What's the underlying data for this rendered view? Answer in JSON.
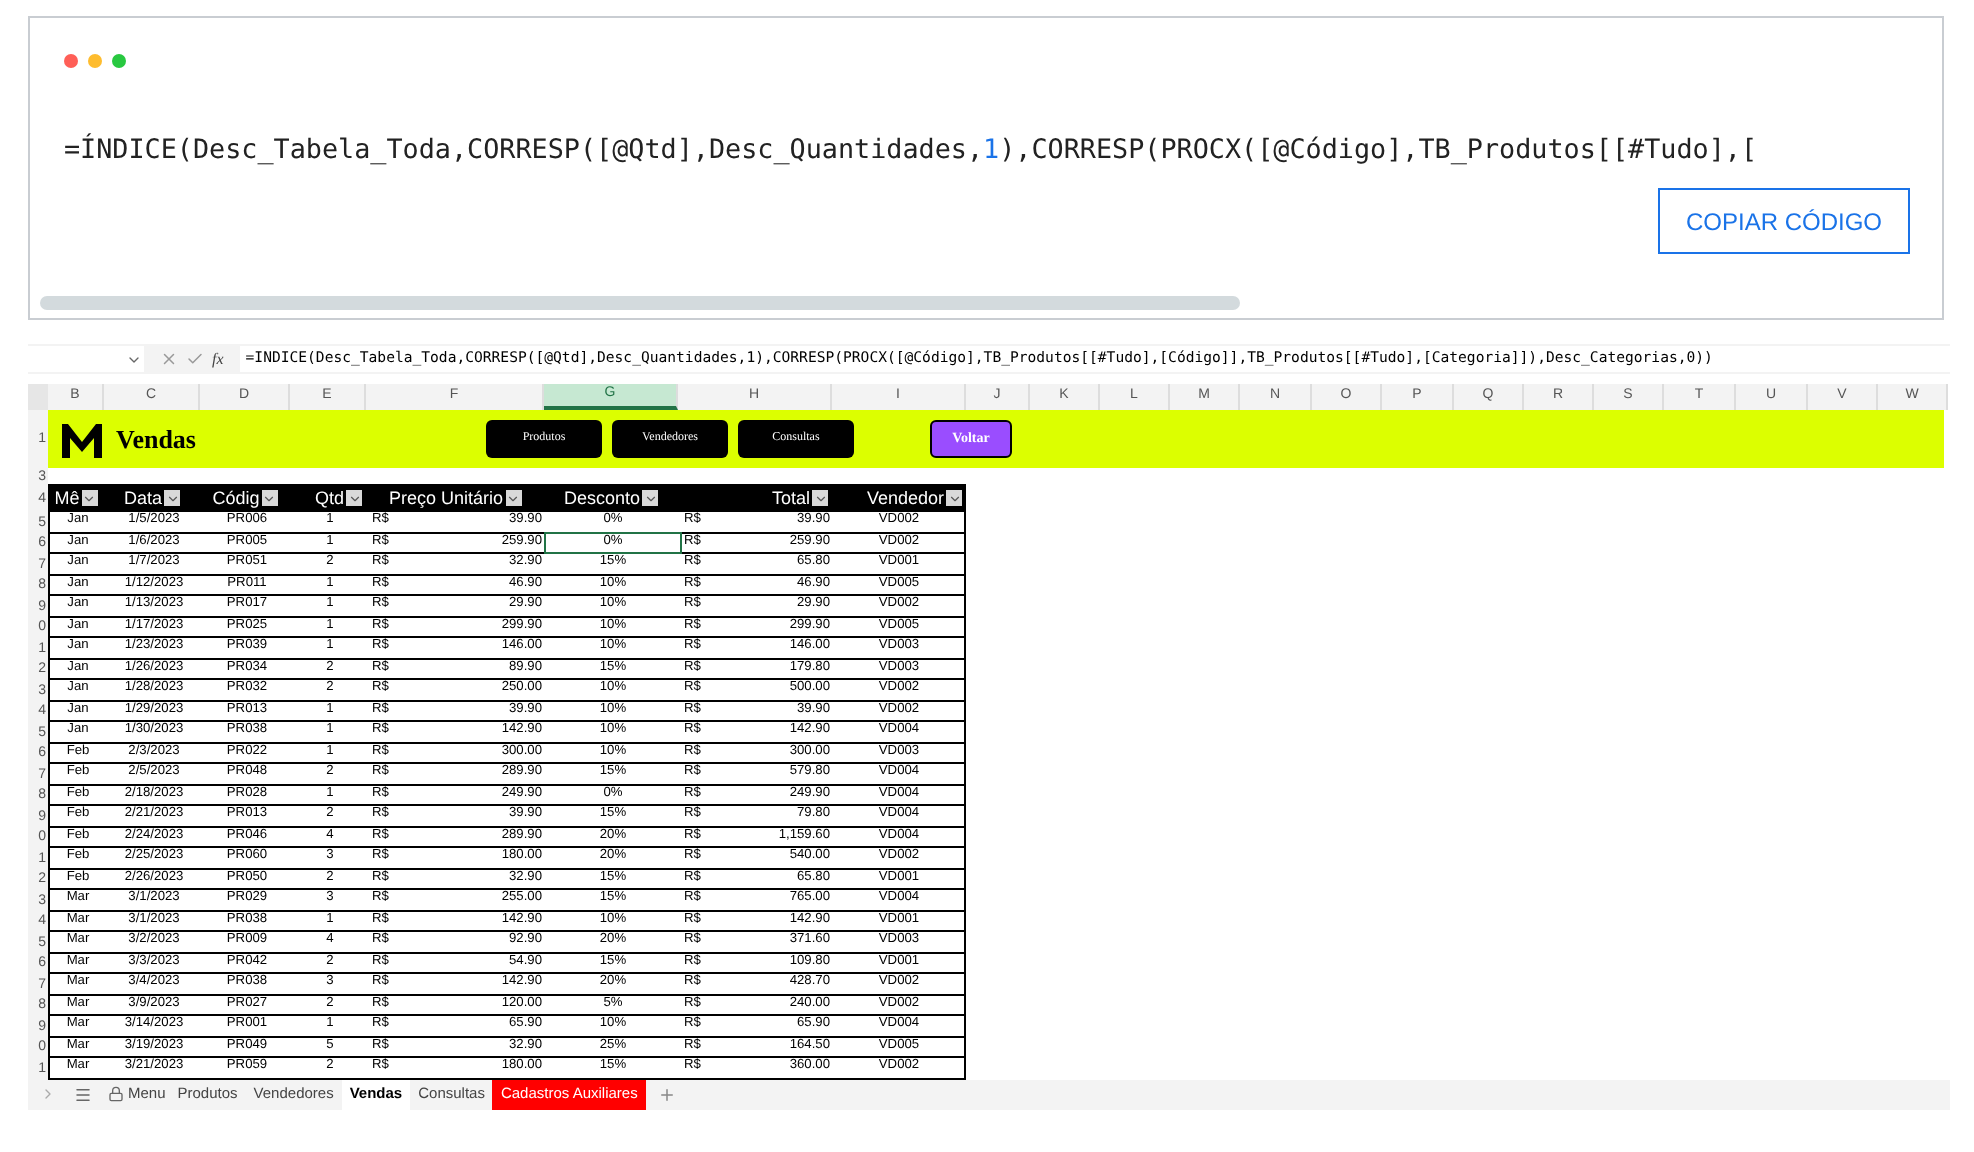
{
  "code_block": {
    "code_parts": [
      {
        "kind": "plain",
        "text": "=ÍNDICE(Desc_Tabela_Toda,CORRESP([@Qtd],Desc_Quantidades,"
      },
      {
        "kind": "number",
        "text": "1"
      },
      {
        "kind": "plain",
        "text": "),CORRESP(PROCX([@Código],TB_Produtos[[#Tudo],["
      }
    ],
    "copy_button": "COPIAR CÓDIGO"
  },
  "formula_bar": {
    "formula": "=INDICE(Desc_Tabela_Toda,CORRESP([@Qtd],Desc_Quantidades,1),CORRESP(PROCX([@Código],TB_Produtos[[#Tudo],[Código]],TB_Produtos[[#Tudo],[Categoria]]),Desc_Categorias,0))",
    "fx": "fx"
  },
  "column_headers": [
    {
      "label": "B",
      "selected": false
    },
    {
      "label": "C",
      "selected": false
    },
    {
      "label": "D",
      "selected": false
    },
    {
      "label": "E",
      "selected": false
    },
    {
      "label": "F",
      "selected": false
    },
    {
      "label": "G",
      "selected": true
    },
    {
      "label": "H",
      "selected": false
    },
    {
      "label": "I",
      "selected": false
    },
    {
      "label": "J",
      "selected": false
    },
    {
      "label": "K",
      "selected": false
    },
    {
      "label": "L",
      "selected": false
    },
    {
      "label": "M",
      "selected": false
    },
    {
      "label": "N",
      "selected": false
    },
    {
      "label": "O",
      "selected": false
    },
    {
      "label": "P",
      "selected": false
    },
    {
      "label": "Q",
      "selected": false
    },
    {
      "label": "R",
      "selected": false
    },
    {
      "label": "S",
      "selected": false
    },
    {
      "label": "T",
      "selected": false
    },
    {
      "label": "U",
      "selected": false
    },
    {
      "label": "V",
      "selected": false
    },
    {
      "label": "W",
      "selected": false
    }
  ],
  "banner": {
    "row_label": "1",
    "title": "Vendas",
    "nav_buttons": [
      "Produtos",
      "Vendedores",
      "Consultas"
    ],
    "back_button": "Voltar"
  },
  "spacer_row_label": "3",
  "table": {
    "row_label": "4",
    "columns": [
      "Mê",
      "Data",
      "Códig",
      "Qtd",
      "Preço Unitário",
      "Desconto",
      "Total",
      "Vendedor"
    ],
    "rows": [
      {
        "row_label": "5",
        "selected": false,
        "cells": [
          "Jan",
          "1/5/2023",
          "PR006",
          "1",
          {
            "currency": "R$",
            "amount": "39.90"
          },
          "0%",
          {
            "currency": "R$",
            "amount": "39.90"
          },
          "VD002"
        ]
      },
      {
        "row_label": "6",
        "selected": true,
        "cells": [
          "Jan",
          "1/6/2023",
          "PR005",
          "1",
          {
            "currency": "R$",
            "amount": "259.90"
          },
          "0%",
          {
            "currency": "R$",
            "amount": "259.90"
          },
          "VD002"
        ]
      },
      {
        "row_label": "7",
        "selected": false,
        "cells": [
          "Jan",
          "1/7/2023",
          "PR051",
          "2",
          {
            "currency": "R$",
            "amount": "32.90"
          },
          "15%",
          {
            "currency": "R$",
            "amount": "65.80"
          },
          "VD001"
        ]
      },
      {
        "row_label": "8",
        "selected": false,
        "cells": [
          "Jan",
          "1/12/2023",
          "PR011",
          "1",
          {
            "currency": "R$",
            "amount": "46.90"
          },
          "10%",
          {
            "currency": "R$",
            "amount": "46.90"
          },
          "VD005"
        ]
      },
      {
        "row_label": "9",
        "selected": false,
        "cells": [
          "Jan",
          "1/13/2023",
          "PR017",
          "1",
          {
            "currency": "R$",
            "amount": "29.90"
          },
          "10%",
          {
            "currency": "R$",
            "amount": "29.90"
          },
          "VD002"
        ]
      },
      {
        "row_label": "0",
        "selected": false,
        "cells": [
          "Jan",
          "1/17/2023",
          "PR025",
          "1",
          {
            "currency": "R$",
            "amount": "299.90"
          },
          "10%",
          {
            "currency": "R$",
            "amount": "299.90"
          },
          "VD005"
        ]
      },
      {
        "row_label": "1",
        "selected": false,
        "cells": [
          "Jan",
          "1/23/2023",
          "PR039",
          "1",
          {
            "currency": "R$",
            "amount": "146.00"
          },
          "10%",
          {
            "currency": "R$",
            "amount": "146.00"
          },
          "VD003"
        ]
      },
      {
        "row_label": "2",
        "selected": false,
        "cells": [
          "Jan",
          "1/26/2023",
          "PR034",
          "2",
          {
            "currency": "R$",
            "amount": "89.90"
          },
          "15%",
          {
            "currency": "R$",
            "amount": "179.80"
          },
          "VD003"
        ]
      },
      {
        "row_label": "3",
        "selected": false,
        "cells": [
          "Jan",
          "1/28/2023",
          "PR032",
          "2",
          {
            "currency": "R$",
            "amount": "250.00"
          },
          "10%",
          {
            "currency": "R$",
            "amount": "500.00"
          },
          "VD002"
        ]
      },
      {
        "row_label": "4",
        "selected": false,
        "cells": [
          "Jan",
          "1/29/2023",
          "PR013",
          "1",
          {
            "currency": "R$",
            "amount": "39.90"
          },
          "10%",
          {
            "currency": "R$",
            "amount": "39.90"
          },
          "VD002"
        ]
      },
      {
        "row_label": "5",
        "selected": false,
        "cells": [
          "Jan",
          "1/30/2023",
          "PR038",
          "1",
          {
            "currency": "R$",
            "amount": "142.90"
          },
          "10%",
          {
            "currency": "R$",
            "amount": "142.90"
          },
          "VD004"
        ]
      },
      {
        "row_label": "6",
        "selected": false,
        "cells": [
          "Feb",
          "2/3/2023",
          "PR022",
          "1",
          {
            "currency": "R$",
            "amount": "300.00"
          },
          "10%",
          {
            "currency": "R$",
            "amount": "300.00"
          },
          "VD003"
        ]
      },
      {
        "row_label": "7",
        "selected": false,
        "cells": [
          "Feb",
          "2/5/2023",
          "PR048",
          "2",
          {
            "currency": "R$",
            "amount": "289.90"
          },
          "15%",
          {
            "currency": "R$",
            "amount": "579.80"
          },
          "VD004"
        ]
      },
      {
        "row_label": "8",
        "selected": false,
        "cells": [
          "Feb",
          "2/18/2023",
          "PR028",
          "1",
          {
            "currency": "R$",
            "amount": "249.90"
          },
          "0%",
          {
            "currency": "R$",
            "amount": "249.90"
          },
          "VD004"
        ]
      },
      {
        "row_label": "9",
        "selected": false,
        "cells": [
          "Feb",
          "2/21/2023",
          "PR013",
          "2",
          {
            "currency": "R$",
            "amount": "39.90"
          },
          "15%",
          {
            "currency": "R$",
            "amount": "79.80"
          },
          "VD004"
        ]
      },
      {
        "row_label": "0",
        "selected": false,
        "cells": [
          "Feb",
          "2/24/2023",
          "PR046",
          "4",
          {
            "currency": "R$",
            "amount": "289.90"
          },
          "20%",
          {
            "currency": "R$",
            "amount": "1,159.60"
          },
          "VD004"
        ]
      },
      {
        "row_label": "1",
        "selected": false,
        "cells": [
          "Feb",
          "2/25/2023",
          "PR060",
          "3",
          {
            "currency": "R$",
            "amount": "180.00"
          },
          "20%",
          {
            "currency": "R$",
            "amount": "540.00"
          },
          "VD002"
        ]
      },
      {
        "row_label": "2",
        "selected": false,
        "cells": [
          "Feb",
          "2/26/2023",
          "PR050",
          "2",
          {
            "currency": "R$",
            "amount": "32.90"
          },
          "15%",
          {
            "currency": "R$",
            "amount": "65.80"
          },
          "VD001"
        ]
      },
      {
        "row_label": "3",
        "selected": false,
        "cells": [
          "Mar",
          "3/1/2023",
          "PR029",
          "3",
          {
            "currency": "R$",
            "amount": "255.00"
          },
          "15%",
          {
            "currency": "R$",
            "amount": "765.00"
          },
          "VD004"
        ]
      },
      {
        "row_label": "4",
        "selected": false,
        "cells": [
          "Mar",
          "3/1/2023",
          "PR038",
          "1",
          {
            "currency": "R$",
            "amount": "142.90"
          },
          "10%",
          {
            "currency": "R$",
            "amount": "142.90"
          },
          "VD001"
        ]
      },
      {
        "row_label": "5",
        "selected": false,
        "cells": [
          "Mar",
          "3/2/2023",
          "PR009",
          "4",
          {
            "currency": "R$",
            "amount": "92.90"
          },
          "20%",
          {
            "currency": "R$",
            "amount": "371.60"
          },
          "VD003"
        ]
      },
      {
        "row_label": "6",
        "selected": false,
        "cells": [
          "Mar",
          "3/3/2023",
          "PR042",
          "2",
          {
            "currency": "R$",
            "amount": "54.90"
          },
          "15%",
          {
            "currency": "R$",
            "amount": "109.80"
          },
          "VD001"
        ]
      },
      {
        "row_label": "7",
        "selected": false,
        "cells": [
          "Mar",
          "3/4/2023",
          "PR038",
          "3",
          {
            "currency": "R$",
            "amount": "142.90"
          },
          "20%",
          {
            "currency": "R$",
            "amount": "428.70"
          },
          "VD002"
        ]
      },
      {
        "row_label": "8",
        "selected": false,
        "cells": [
          "Mar",
          "3/9/2023",
          "PR027",
          "2",
          {
            "currency": "R$",
            "amount": "120.00"
          },
          "5%",
          {
            "currency": "R$",
            "amount": "240.00"
          },
          "VD002"
        ]
      },
      {
        "row_label": "9",
        "selected": false,
        "cells": [
          "Mar",
          "3/14/2023",
          "PR001",
          "1",
          {
            "currency": "R$",
            "amount": "65.90"
          },
          "10%",
          {
            "currency": "R$",
            "amount": "65.90"
          },
          "VD004"
        ]
      },
      {
        "row_label": "0",
        "selected": false,
        "cells": [
          "Mar",
          "3/19/2023",
          "PR049",
          "5",
          {
            "currency": "R$",
            "amount": "32.90"
          },
          "25%",
          {
            "currency": "R$",
            "amount": "164.50"
          },
          "VD005"
        ]
      },
      {
        "row_label": "1",
        "selected": false,
        "cells": [
          "Mar",
          "3/21/2023",
          "PR059",
          "2",
          {
            "currency": "R$",
            "amount": "180.00"
          },
          "15%",
          {
            "currency": "R$",
            "amount": "360.00"
          },
          "VD002"
        ]
      }
    ]
  },
  "sheet_tabs": {
    "menu": "Menu",
    "tabs": [
      {
        "label": "Produtos",
        "selected": false
      },
      {
        "label": "Vendedores",
        "selected": false
      },
      {
        "label": "Vendas",
        "selected": true
      },
      {
        "label": "Consultas",
        "selected": false
      },
      {
        "label": "Cadastros Auxiliares",
        "selected": false,
        "color": "#ff0000"
      }
    ]
  }
}
